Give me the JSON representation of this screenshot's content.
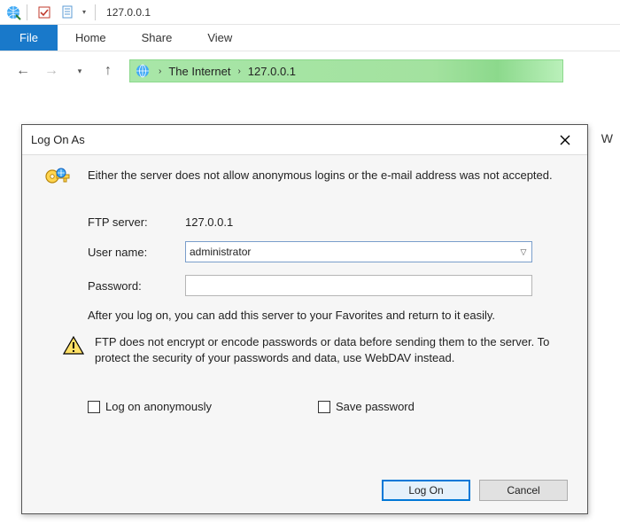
{
  "titlebar": {
    "title": "127.0.0.1"
  },
  "ribbon": {
    "file": "File",
    "home": "Home",
    "share": "Share",
    "view": "View"
  },
  "addressbar": {
    "root": "The Internet",
    "leaf": "127.0.0.1"
  },
  "right_char": "W",
  "dialog": {
    "title": "Log On As",
    "message": "Either the server does not allow anonymous logins or the e-mail address was not accepted.",
    "ftp_server_label": "FTP server:",
    "ftp_server_value": "127.0.0.1",
    "username_label": "User name:",
    "username_value": "administrator",
    "password_label": "Password:",
    "password_value": "",
    "after_message": "After you log on, you can add this server to your Favorites and return to it easily.",
    "warning_message": "FTP does not encrypt or encode passwords or data before sending them to the server.  To protect the security of your passwords and data, use WebDAV instead.",
    "anon_label": "Log on anonymously",
    "savepw_label": "Save password",
    "logon_btn": "Log On",
    "cancel_btn": "Cancel"
  }
}
